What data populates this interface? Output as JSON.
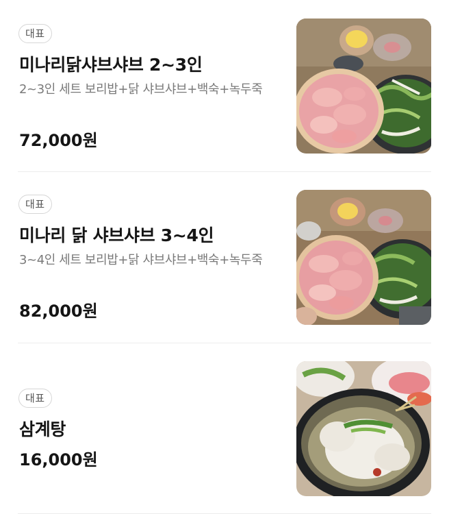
{
  "menu": {
    "items": [
      {
        "badge": "대표",
        "title": "미나리닭샤브샤브 2~3인",
        "description": "2~3인 세트 보리밥+닭 샤브샤브+백숙+녹두죽",
        "price": "72,000원",
        "image_icon": "chicken-shabu-photo"
      },
      {
        "badge": "대표",
        "title": "미나리 닭 샤브샤브 3~4인",
        "description": "3~4인 세트 보리밥+닭 샤브샤브+백숙+녹두죽",
        "price": "82,000원",
        "image_icon": "chicken-shabu-photo"
      },
      {
        "badge": "대표",
        "title": "삼계탕",
        "price": "16,000원",
        "image_icon": "samgyetang-photo"
      }
    ]
  }
}
